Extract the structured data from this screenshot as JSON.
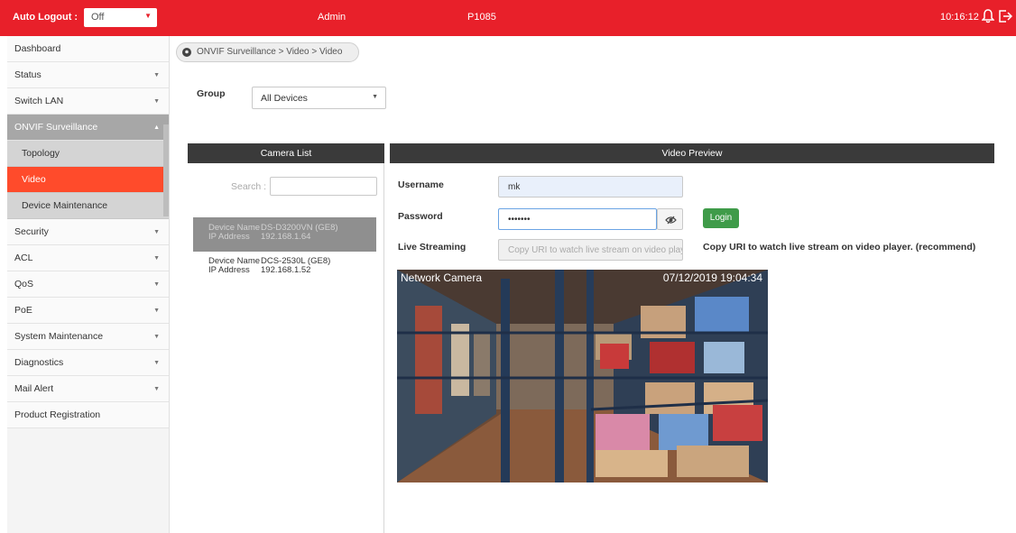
{
  "topbar": {
    "auto_logout_label": "Auto Logout :",
    "auto_logout_value": "Off",
    "user": "Admin",
    "model": "P1085",
    "time": "10:16:12"
  },
  "sidebar": {
    "items": [
      {
        "label": "Dashboard",
        "arrow": ""
      },
      {
        "label": "Status",
        "arrow": "▼"
      },
      {
        "label": "Switch LAN",
        "arrow": "▼"
      },
      {
        "label": "ONVIF Surveillance",
        "arrow": "▲"
      },
      {
        "label": "Topology",
        "arrow": ""
      },
      {
        "label": "Video",
        "arrow": ""
      },
      {
        "label": "Device Maintenance",
        "arrow": ""
      },
      {
        "label": "Security",
        "arrow": "▼"
      },
      {
        "label": "ACL",
        "arrow": "▼"
      },
      {
        "label": "QoS",
        "arrow": "▼"
      },
      {
        "label": "PoE",
        "arrow": "▼"
      },
      {
        "label": "System Maintenance",
        "arrow": "▼"
      },
      {
        "label": "Diagnostics",
        "arrow": "▼"
      },
      {
        "label": "Mail Alert",
        "arrow": "▼"
      },
      {
        "label": "Product Registration",
        "arrow": ""
      }
    ]
  },
  "breadcrumb": "ONVIF Surveillance > Video > Video",
  "group": {
    "label": "Group",
    "value": "All Devices"
  },
  "camera_list": {
    "title": "Camera List",
    "search_label": "Search :",
    "cameras": [
      {
        "name_label": "Device Name",
        "name": "DS-D3200VN (GE8)",
        "ip_label": "IP Address",
        "ip": "192.168.1.64"
      },
      {
        "name_label": "Device Name",
        "name": "DCS-2530L (GE8)",
        "ip_label": "IP Address",
        "ip": "192.168.1.52"
      }
    ]
  },
  "preview": {
    "title": "Video Preview",
    "username_label": "Username",
    "username_value": "mk",
    "password_label": "Password",
    "password_value": "•••••••",
    "login_label": "Login",
    "live_label": "Live Streaming",
    "live_placeholder": "Copy URI to watch live stream on video player.",
    "recommend": "Copy URI to watch live stream on video player. (recommend)",
    "osd_left": "Network Camera",
    "osd_right": "07/12/2019  19:04:34"
  },
  "colors": {
    "brand": "#e8202a",
    "active": "#ff4b2b",
    "login": "#3f9b49"
  }
}
